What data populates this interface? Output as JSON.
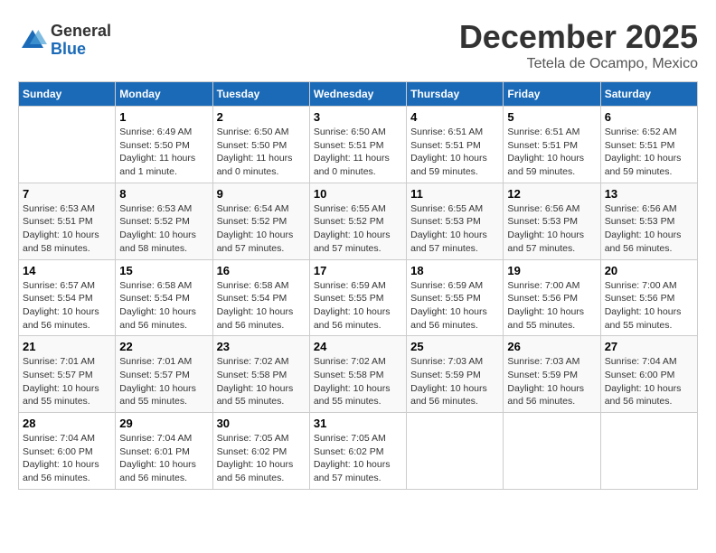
{
  "logo": {
    "general": "General",
    "blue": "Blue"
  },
  "title": "December 2025",
  "location": "Tetela de Ocampo, Mexico",
  "weekdays": [
    "Sunday",
    "Monday",
    "Tuesday",
    "Wednesday",
    "Thursday",
    "Friday",
    "Saturday"
  ],
  "weeks": [
    [
      {
        "day": "",
        "info": ""
      },
      {
        "day": "1",
        "info": "Sunrise: 6:49 AM\nSunset: 5:50 PM\nDaylight: 11 hours\nand 1 minute."
      },
      {
        "day": "2",
        "info": "Sunrise: 6:50 AM\nSunset: 5:50 PM\nDaylight: 11 hours\nand 0 minutes."
      },
      {
        "day": "3",
        "info": "Sunrise: 6:50 AM\nSunset: 5:51 PM\nDaylight: 11 hours\nand 0 minutes."
      },
      {
        "day": "4",
        "info": "Sunrise: 6:51 AM\nSunset: 5:51 PM\nDaylight: 10 hours\nand 59 minutes."
      },
      {
        "day": "5",
        "info": "Sunrise: 6:51 AM\nSunset: 5:51 PM\nDaylight: 10 hours\nand 59 minutes."
      },
      {
        "day": "6",
        "info": "Sunrise: 6:52 AM\nSunset: 5:51 PM\nDaylight: 10 hours\nand 59 minutes."
      }
    ],
    [
      {
        "day": "7",
        "info": "Sunrise: 6:53 AM\nSunset: 5:51 PM\nDaylight: 10 hours\nand 58 minutes."
      },
      {
        "day": "8",
        "info": "Sunrise: 6:53 AM\nSunset: 5:52 PM\nDaylight: 10 hours\nand 58 minutes."
      },
      {
        "day": "9",
        "info": "Sunrise: 6:54 AM\nSunset: 5:52 PM\nDaylight: 10 hours\nand 57 minutes."
      },
      {
        "day": "10",
        "info": "Sunrise: 6:55 AM\nSunset: 5:52 PM\nDaylight: 10 hours\nand 57 minutes."
      },
      {
        "day": "11",
        "info": "Sunrise: 6:55 AM\nSunset: 5:53 PM\nDaylight: 10 hours\nand 57 minutes."
      },
      {
        "day": "12",
        "info": "Sunrise: 6:56 AM\nSunset: 5:53 PM\nDaylight: 10 hours\nand 57 minutes."
      },
      {
        "day": "13",
        "info": "Sunrise: 6:56 AM\nSunset: 5:53 PM\nDaylight: 10 hours\nand 56 minutes."
      }
    ],
    [
      {
        "day": "14",
        "info": "Sunrise: 6:57 AM\nSunset: 5:54 PM\nDaylight: 10 hours\nand 56 minutes."
      },
      {
        "day": "15",
        "info": "Sunrise: 6:58 AM\nSunset: 5:54 PM\nDaylight: 10 hours\nand 56 minutes."
      },
      {
        "day": "16",
        "info": "Sunrise: 6:58 AM\nSunset: 5:54 PM\nDaylight: 10 hours\nand 56 minutes."
      },
      {
        "day": "17",
        "info": "Sunrise: 6:59 AM\nSunset: 5:55 PM\nDaylight: 10 hours\nand 56 minutes."
      },
      {
        "day": "18",
        "info": "Sunrise: 6:59 AM\nSunset: 5:55 PM\nDaylight: 10 hours\nand 56 minutes."
      },
      {
        "day": "19",
        "info": "Sunrise: 7:00 AM\nSunset: 5:56 PM\nDaylight: 10 hours\nand 55 minutes."
      },
      {
        "day": "20",
        "info": "Sunrise: 7:00 AM\nSunset: 5:56 PM\nDaylight: 10 hours\nand 55 minutes."
      }
    ],
    [
      {
        "day": "21",
        "info": "Sunrise: 7:01 AM\nSunset: 5:57 PM\nDaylight: 10 hours\nand 55 minutes."
      },
      {
        "day": "22",
        "info": "Sunrise: 7:01 AM\nSunset: 5:57 PM\nDaylight: 10 hours\nand 55 minutes."
      },
      {
        "day": "23",
        "info": "Sunrise: 7:02 AM\nSunset: 5:58 PM\nDaylight: 10 hours\nand 55 minutes."
      },
      {
        "day": "24",
        "info": "Sunrise: 7:02 AM\nSunset: 5:58 PM\nDaylight: 10 hours\nand 55 minutes."
      },
      {
        "day": "25",
        "info": "Sunrise: 7:03 AM\nSunset: 5:59 PM\nDaylight: 10 hours\nand 56 minutes."
      },
      {
        "day": "26",
        "info": "Sunrise: 7:03 AM\nSunset: 5:59 PM\nDaylight: 10 hours\nand 56 minutes."
      },
      {
        "day": "27",
        "info": "Sunrise: 7:04 AM\nSunset: 6:00 PM\nDaylight: 10 hours\nand 56 minutes."
      }
    ],
    [
      {
        "day": "28",
        "info": "Sunrise: 7:04 AM\nSunset: 6:00 PM\nDaylight: 10 hours\nand 56 minutes."
      },
      {
        "day": "29",
        "info": "Sunrise: 7:04 AM\nSunset: 6:01 PM\nDaylight: 10 hours\nand 56 minutes."
      },
      {
        "day": "30",
        "info": "Sunrise: 7:05 AM\nSunset: 6:02 PM\nDaylight: 10 hours\nand 56 minutes."
      },
      {
        "day": "31",
        "info": "Sunrise: 7:05 AM\nSunset: 6:02 PM\nDaylight: 10 hours\nand 57 minutes."
      },
      {
        "day": "",
        "info": ""
      },
      {
        "day": "",
        "info": ""
      },
      {
        "day": "",
        "info": ""
      }
    ]
  ]
}
